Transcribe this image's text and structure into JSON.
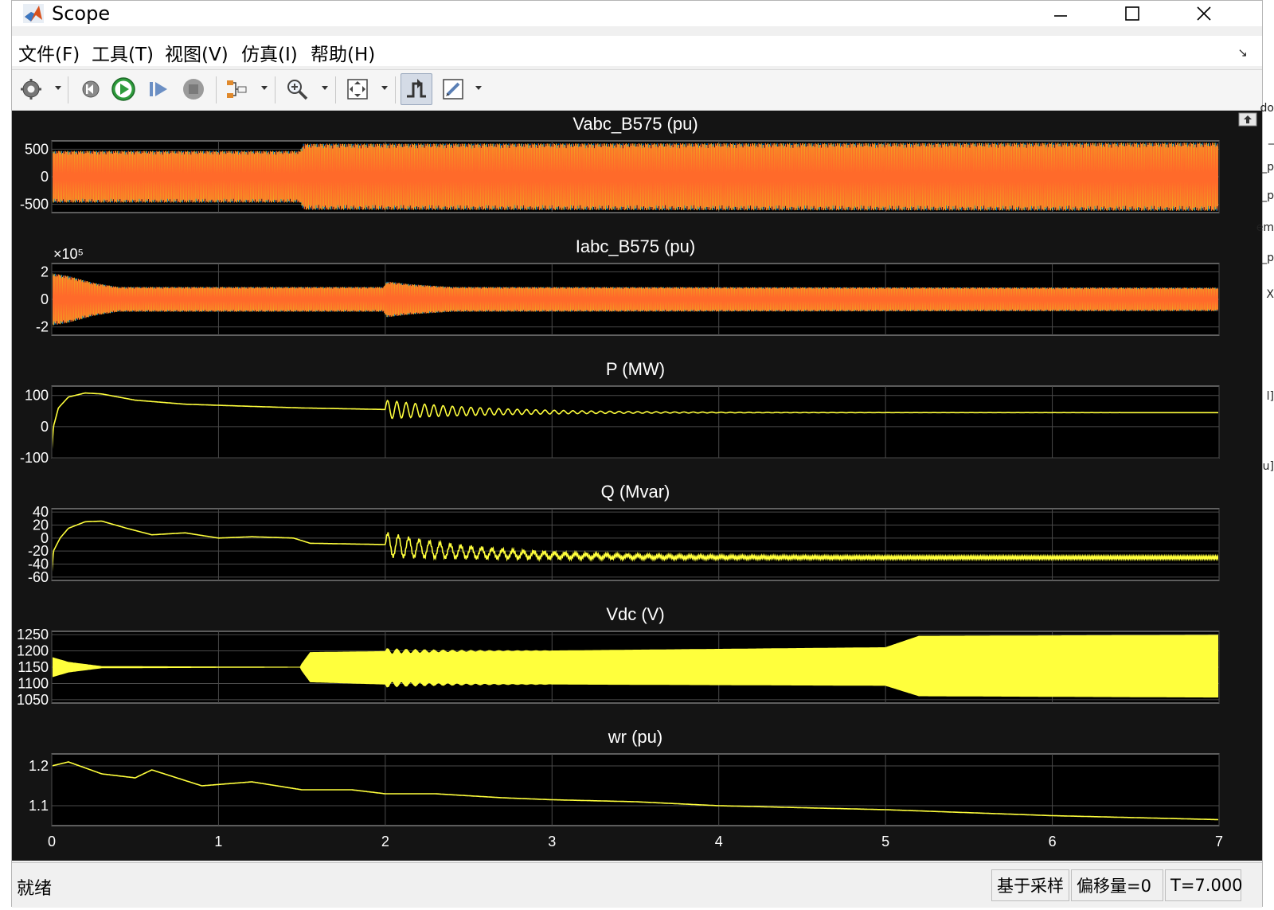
{
  "window": {
    "title": "Scope"
  },
  "menu": [
    {
      "label": "文件(F)"
    },
    {
      "label": "工具(T)"
    },
    {
      "label": "视图(V)"
    },
    {
      "label": "仿真(I)"
    },
    {
      "label": "帮助(H)"
    }
  ],
  "toolbar_icons": [
    "gear-icon",
    "restart-icon",
    "run-icon",
    "step-forward-icon",
    "stop-icon",
    "signal-select-icon",
    "zoom-icon",
    "fit-axes-icon",
    "trigger-icon",
    "edit-icon"
  ],
  "status": {
    "text": "就绪",
    "sample_mode": "基于采样",
    "offset": "偏移量=0",
    "time": "T=7.000"
  },
  "edge_fragments": [
    "do",
    "_",
    "_p",
    "_p",
    "em",
    "_p",
    "X",
    "l]",
    "u]"
  ],
  "chart_data": [
    {
      "type": "line",
      "title": "Vabc_B575 (pu)",
      "xlim": [
        0,
        7
      ],
      "ylim": [
        -650,
        650
      ],
      "yticks": [
        -500,
        0,
        500
      ],
      "ytick_labels": [
        "-500",
        "0",
        "500"
      ],
      "series_colors": [
        "#0072bd",
        "#edb120",
        "#ff6a2a"
      ],
      "series": [
        {
          "x": [
            0,
            1.49,
            1.51,
            7
          ],
          "y_amplitude": [
            470,
            470,
            600,
            620
          ]
        }
      ]
    },
    {
      "type": "line",
      "title": "Iabc_B575 (pu)",
      "xlim": [
        0,
        7
      ],
      "ylim": [
        -2.6,
        2.6
      ],
      "yticks": [
        -2,
        0,
        2
      ],
      "ytick_labels": [
        "-2",
        "0",
        "2"
      ],
      "exponent_label": "×10⁵",
      "series_colors": [
        "#0072bd",
        "#edb120",
        "#ff6a2a"
      ],
      "series": [
        {
          "x": [
            0,
            0.1,
            0.25,
            0.4,
            1.99,
            2.01,
            2.15,
            2.4,
            7
          ],
          "y_amplitude": [
            1.9,
            1.7,
            1.2,
            0.9,
            0.9,
            1.3,
            1.1,
            0.9,
            0.85
          ]
        }
      ]
    },
    {
      "type": "line",
      "title": "P (MW)",
      "xlim": [
        0,
        7
      ],
      "ylim": [
        -100,
        130
      ],
      "yticks": [
        -100,
        0,
        100
      ],
      "ytick_labels": [
        "-100",
        "0",
        "100"
      ],
      "series_colors": [
        "#ffff3c"
      ],
      "series": [
        {
          "x": [
            0,
            0.01,
            0.04,
            0.1,
            0.2,
            0.3,
            0.5,
            0.8,
            1.2,
            1.5,
            2.0
          ],
          "y": [
            -80,
            0,
            60,
            95,
            108,
            105,
            85,
            72,
            65,
            60,
            55
          ]
        }
      ],
      "disturbance": {
        "t": 2.0,
        "amp": 30,
        "freq": 18,
        "decay": 1.6,
        "final": 45
      }
    },
    {
      "type": "line",
      "title": "Q (Mvar)",
      "xlim": [
        0,
        7
      ],
      "ylim": [
        -65,
        45
      ],
      "yticks": [
        -60,
        -40,
        -20,
        0,
        20,
        40
      ],
      "ytick_labels": [
        "-60",
        "-40",
        "-20",
        "0",
        "20",
        "40"
      ],
      "series_colors": [
        "#ffff3c"
      ],
      "series": [
        {
          "x": [
            0,
            0.01,
            0.05,
            0.1,
            0.2,
            0.3,
            0.45,
            0.6,
            0.8,
            1.0,
            1.2,
            1.45,
            1.55,
            2.0
          ],
          "y": [
            -55,
            -20,
            0,
            15,
            25,
            26,
            15,
            5,
            8,
            0,
            2,
            0,
            -8,
            -10
          ]
        }
      ],
      "disturbance": {
        "t": 2.0,
        "amp": 18,
        "freq": 16,
        "decay": 1.4,
        "final": -30,
        "ripple": 4
      }
    },
    {
      "type": "line",
      "title": "Vdc (V)",
      "xlim": [
        0,
        7
      ],
      "ylim": [
        1040,
        1260
      ],
      "yticks": [
        1050,
        1100,
        1150,
        1200,
        1250
      ],
      "ytick_labels": [
        "1050",
        "1100",
        "1150",
        "1200",
        "1250"
      ],
      "series_colors": [
        "#ffff3c"
      ],
      "series": [
        {
          "x": [
            0,
            0.1,
            0.3,
            1.49,
            1.5,
            1.55,
            2.0,
            3.0,
            4.0,
            5.0,
            5.2,
            7.0
          ],
          "y_upper": [
            1180,
            1165,
            1152,
            1150,
            1160,
            1195,
            1198,
            1200,
            1205,
            1210,
            1245,
            1248
          ],
          "y_lower": [
            1120,
            1135,
            1148,
            1150,
            1140,
            1105,
            1098,
            1098,
            1096,
            1094,
            1062,
            1058
          ]
        }
      ]
    },
    {
      "type": "line",
      "title": "wr (pu)",
      "xlim": [
        0,
        7
      ],
      "ylim": [
        1.05,
        1.23
      ],
      "yticks": [
        1.1,
        1.2
      ],
      "ytick_labels": [
        "1.1",
        "1.2"
      ],
      "xticks": [
        0,
        1,
        2,
        3,
        4,
        5,
        6,
        7
      ],
      "xtick_labels": [
        "0",
        "1",
        "2",
        "3",
        "4",
        "5",
        "6",
        "7"
      ],
      "series_colors": [
        "#ffff3c"
      ],
      "series": [
        {
          "x": [
            0,
            0.1,
            0.3,
            0.5,
            0.6,
            0.9,
            1.2,
            1.5,
            1.8,
            2.0,
            2.3,
            2.7,
            3.0,
            3.5,
            4.0,
            5.0,
            6.0,
            7.0
          ],
          "y": [
            1.2,
            1.21,
            1.18,
            1.17,
            1.19,
            1.15,
            1.16,
            1.14,
            1.14,
            1.13,
            1.13,
            1.12,
            1.115,
            1.11,
            1.1,
            1.09,
            1.075,
            1.065
          ]
        }
      ]
    }
  ]
}
